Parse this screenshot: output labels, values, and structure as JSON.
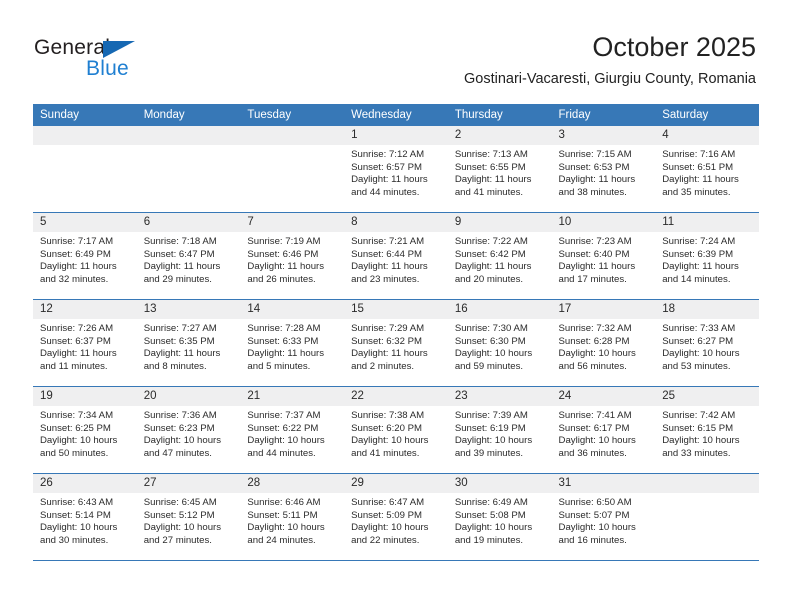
{
  "brand": {
    "name_part1": "General",
    "name_part2": "Blue"
  },
  "header": {
    "month_title": "October 2025",
    "location": "Gostinari-Vacaresti, Giurgiu County, Romania"
  },
  "theme": {
    "header_blue": "#3778b7",
    "logo_blue": "#1f7fd1",
    "daynum_background": "#efeff0"
  },
  "weekday_headers": [
    "Sunday",
    "Monday",
    "Tuesday",
    "Wednesday",
    "Thursday",
    "Friday",
    "Saturday"
  ],
  "weeks": [
    [
      {
        "day": "",
        "empty": true,
        "sunrise": "",
        "sunset": "",
        "daylight1": "",
        "daylight2": ""
      },
      {
        "day": "",
        "empty": true,
        "sunrise": "",
        "sunset": "",
        "daylight1": "",
        "daylight2": ""
      },
      {
        "day": "",
        "empty": true,
        "sunrise": "",
        "sunset": "",
        "daylight1": "",
        "daylight2": ""
      },
      {
        "day": "1",
        "empty": false,
        "sunrise": "Sunrise: 7:12 AM",
        "sunset": "Sunset: 6:57 PM",
        "daylight1": "Daylight: 11 hours",
        "daylight2": "and 44 minutes."
      },
      {
        "day": "2",
        "empty": false,
        "sunrise": "Sunrise: 7:13 AM",
        "sunset": "Sunset: 6:55 PM",
        "daylight1": "Daylight: 11 hours",
        "daylight2": "and 41 minutes."
      },
      {
        "day": "3",
        "empty": false,
        "sunrise": "Sunrise: 7:15 AM",
        "sunset": "Sunset: 6:53 PM",
        "daylight1": "Daylight: 11 hours",
        "daylight2": "and 38 minutes."
      },
      {
        "day": "4",
        "empty": false,
        "sunrise": "Sunrise: 7:16 AM",
        "sunset": "Sunset: 6:51 PM",
        "daylight1": "Daylight: 11 hours",
        "daylight2": "and 35 minutes."
      }
    ],
    [
      {
        "day": "5",
        "empty": false,
        "sunrise": "Sunrise: 7:17 AM",
        "sunset": "Sunset: 6:49 PM",
        "daylight1": "Daylight: 11 hours",
        "daylight2": "and 32 minutes."
      },
      {
        "day": "6",
        "empty": false,
        "sunrise": "Sunrise: 7:18 AM",
        "sunset": "Sunset: 6:47 PM",
        "daylight1": "Daylight: 11 hours",
        "daylight2": "and 29 minutes."
      },
      {
        "day": "7",
        "empty": false,
        "sunrise": "Sunrise: 7:19 AM",
        "sunset": "Sunset: 6:46 PM",
        "daylight1": "Daylight: 11 hours",
        "daylight2": "and 26 minutes."
      },
      {
        "day": "8",
        "empty": false,
        "sunrise": "Sunrise: 7:21 AM",
        "sunset": "Sunset: 6:44 PM",
        "daylight1": "Daylight: 11 hours",
        "daylight2": "and 23 minutes."
      },
      {
        "day": "9",
        "empty": false,
        "sunrise": "Sunrise: 7:22 AM",
        "sunset": "Sunset: 6:42 PM",
        "daylight1": "Daylight: 11 hours",
        "daylight2": "and 20 minutes."
      },
      {
        "day": "10",
        "empty": false,
        "sunrise": "Sunrise: 7:23 AM",
        "sunset": "Sunset: 6:40 PM",
        "daylight1": "Daylight: 11 hours",
        "daylight2": "and 17 minutes."
      },
      {
        "day": "11",
        "empty": false,
        "sunrise": "Sunrise: 7:24 AM",
        "sunset": "Sunset: 6:39 PM",
        "daylight1": "Daylight: 11 hours",
        "daylight2": "and 14 minutes."
      }
    ],
    [
      {
        "day": "12",
        "empty": false,
        "sunrise": "Sunrise: 7:26 AM",
        "sunset": "Sunset: 6:37 PM",
        "daylight1": "Daylight: 11 hours",
        "daylight2": "and 11 minutes."
      },
      {
        "day": "13",
        "empty": false,
        "sunrise": "Sunrise: 7:27 AM",
        "sunset": "Sunset: 6:35 PM",
        "daylight1": "Daylight: 11 hours",
        "daylight2": "and 8 minutes."
      },
      {
        "day": "14",
        "empty": false,
        "sunrise": "Sunrise: 7:28 AM",
        "sunset": "Sunset: 6:33 PM",
        "daylight1": "Daylight: 11 hours",
        "daylight2": "and 5 minutes."
      },
      {
        "day": "15",
        "empty": false,
        "sunrise": "Sunrise: 7:29 AM",
        "sunset": "Sunset: 6:32 PM",
        "daylight1": "Daylight: 11 hours",
        "daylight2": "and 2 minutes."
      },
      {
        "day": "16",
        "empty": false,
        "sunrise": "Sunrise: 7:30 AM",
        "sunset": "Sunset: 6:30 PM",
        "daylight1": "Daylight: 10 hours",
        "daylight2": "and 59 minutes."
      },
      {
        "day": "17",
        "empty": false,
        "sunrise": "Sunrise: 7:32 AM",
        "sunset": "Sunset: 6:28 PM",
        "daylight1": "Daylight: 10 hours",
        "daylight2": "and 56 minutes."
      },
      {
        "day": "18",
        "empty": false,
        "sunrise": "Sunrise: 7:33 AM",
        "sunset": "Sunset: 6:27 PM",
        "daylight1": "Daylight: 10 hours",
        "daylight2": "and 53 minutes."
      }
    ],
    [
      {
        "day": "19",
        "empty": false,
        "sunrise": "Sunrise: 7:34 AM",
        "sunset": "Sunset: 6:25 PM",
        "daylight1": "Daylight: 10 hours",
        "daylight2": "and 50 minutes."
      },
      {
        "day": "20",
        "empty": false,
        "sunrise": "Sunrise: 7:36 AM",
        "sunset": "Sunset: 6:23 PM",
        "daylight1": "Daylight: 10 hours",
        "daylight2": "and 47 minutes."
      },
      {
        "day": "21",
        "empty": false,
        "sunrise": "Sunrise: 7:37 AM",
        "sunset": "Sunset: 6:22 PM",
        "daylight1": "Daylight: 10 hours",
        "daylight2": "and 44 minutes."
      },
      {
        "day": "22",
        "empty": false,
        "sunrise": "Sunrise: 7:38 AM",
        "sunset": "Sunset: 6:20 PM",
        "daylight1": "Daylight: 10 hours",
        "daylight2": "and 41 minutes."
      },
      {
        "day": "23",
        "empty": false,
        "sunrise": "Sunrise: 7:39 AM",
        "sunset": "Sunset: 6:19 PM",
        "daylight1": "Daylight: 10 hours",
        "daylight2": "and 39 minutes."
      },
      {
        "day": "24",
        "empty": false,
        "sunrise": "Sunrise: 7:41 AM",
        "sunset": "Sunset: 6:17 PM",
        "daylight1": "Daylight: 10 hours",
        "daylight2": "and 36 minutes."
      },
      {
        "day": "25",
        "empty": false,
        "sunrise": "Sunrise: 7:42 AM",
        "sunset": "Sunset: 6:15 PM",
        "daylight1": "Daylight: 10 hours",
        "daylight2": "and 33 minutes."
      }
    ],
    [
      {
        "day": "26",
        "empty": false,
        "sunrise": "Sunrise: 6:43 AM",
        "sunset": "Sunset: 5:14 PM",
        "daylight1": "Daylight: 10 hours",
        "daylight2": "and 30 minutes."
      },
      {
        "day": "27",
        "empty": false,
        "sunrise": "Sunrise: 6:45 AM",
        "sunset": "Sunset: 5:12 PM",
        "daylight1": "Daylight: 10 hours",
        "daylight2": "and 27 minutes."
      },
      {
        "day": "28",
        "empty": false,
        "sunrise": "Sunrise: 6:46 AM",
        "sunset": "Sunset: 5:11 PM",
        "daylight1": "Daylight: 10 hours",
        "daylight2": "and 24 minutes."
      },
      {
        "day": "29",
        "empty": false,
        "sunrise": "Sunrise: 6:47 AM",
        "sunset": "Sunset: 5:09 PM",
        "daylight1": "Daylight: 10 hours",
        "daylight2": "and 22 minutes."
      },
      {
        "day": "30",
        "empty": false,
        "sunrise": "Sunrise: 6:49 AM",
        "sunset": "Sunset: 5:08 PM",
        "daylight1": "Daylight: 10 hours",
        "daylight2": "and 19 minutes."
      },
      {
        "day": "31",
        "empty": false,
        "sunrise": "Sunrise: 6:50 AM",
        "sunset": "Sunset: 5:07 PM",
        "daylight1": "Daylight: 10 hours",
        "daylight2": "and 16 minutes."
      },
      {
        "day": "",
        "empty": true,
        "sunrise": "",
        "sunset": "",
        "daylight1": "",
        "daylight2": ""
      }
    ]
  ]
}
